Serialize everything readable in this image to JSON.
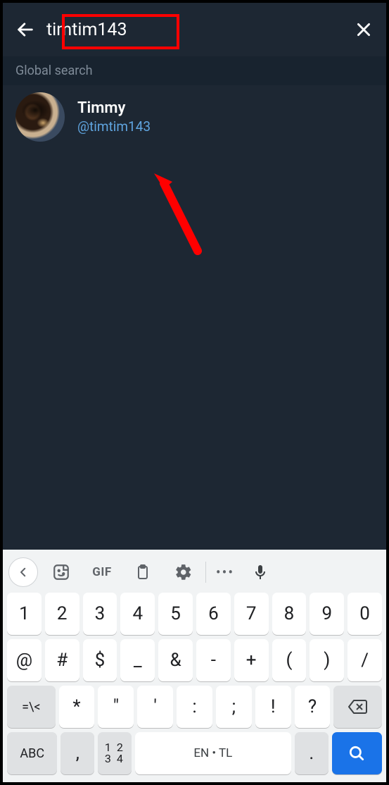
{
  "header": {
    "search_value": "timtim143",
    "back_icon": "arrow-left",
    "clear_icon": "close"
  },
  "section": {
    "title": "Global search"
  },
  "results": [
    {
      "name": "Timmy",
      "handle": "@timtim143"
    }
  ],
  "keyboard": {
    "toolbar": {
      "collapse": "<",
      "sticker": "sticker",
      "gif": "GIF",
      "clipboard": "clipboard",
      "settings": "settings",
      "more": "•••",
      "mic": "mic"
    },
    "row1": [
      "1",
      "2",
      "3",
      "4",
      "5",
      "6",
      "7",
      "8",
      "9",
      "0"
    ],
    "row2": [
      "@",
      "#",
      "$",
      "_",
      "&",
      "-",
      "+",
      "(",
      ")",
      "/"
    ],
    "row3_shift": "=\\<",
    "row3": [
      "*",
      "\"",
      "'",
      ":",
      ";",
      "!",
      "?"
    ],
    "row3_back": "backspace",
    "row4": {
      "mode": "ABC",
      "comma": ",",
      "numpad_top": "1 2",
      "numpad_bot": "3 4",
      "space": "EN • TL",
      "period": ".",
      "search": "search"
    }
  }
}
